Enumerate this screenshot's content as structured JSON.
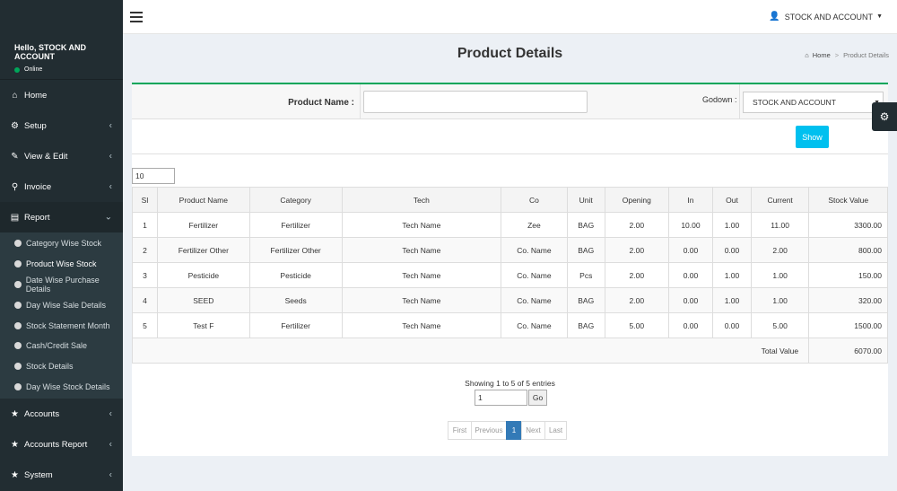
{
  "sidebar": {
    "greeting": "Hello, STOCK AND ACCOUNT",
    "status": "Online",
    "items": {
      "home": "Home",
      "setup": "Setup",
      "view_edit": "View & Edit",
      "invoice": "Invoice",
      "report": "Report",
      "accounts": "Accounts",
      "accounts_report": "Accounts Report",
      "system": "System"
    },
    "report_sub": [
      "Category Wise Stock",
      "Product Wise Stock",
      "Date Wise Purchase Details",
      "Day Wise Sale Details",
      "Stock Statement Month",
      "Cash/Credit Sale",
      "Stock Details",
      "Day Wise Stock Details"
    ]
  },
  "header": {
    "user": "STOCK AND ACCOUNT"
  },
  "page": {
    "title": "Product Details",
    "breadcrumb_home": "Home",
    "breadcrumb_current": "Product Details"
  },
  "filters": {
    "product_label": "Product Name :",
    "product_value": "",
    "godown_label": "Godown :",
    "godown_value": "STOCK AND ACCOUNT",
    "show_label": "Show"
  },
  "table": {
    "page_length": "10",
    "columns": [
      "Sl",
      "Product Name",
      "Category",
      "Tech",
      "Co",
      "Unit",
      "Opening",
      "In",
      "Out",
      "Current",
      "Stock Value"
    ],
    "rows": [
      [
        "1",
        "Fertilizer",
        "Fertilizer",
        "Tech Name",
        "Zee",
        "BAG",
        "2.00",
        "10.00",
        "1.00",
        "11.00",
        "3300.00"
      ],
      [
        "2",
        "Fertilizer Other",
        "Fertilizer Other",
        "Tech Name",
        "Co. Name",
        "BAG",
        "2.00",
        "0.00",
        "0.00",
        "2.00",
        "800.00"
      ],
      [
        "3",
        "Pesticide",
        "Pesticide",
        "Tech Name",
        "Co. Name",
        "Pcs",
        "2.00",
        "0.00",
        "1.00",
        "1.00",
        "150.00"
      ],
      [
        "4",
        "SEED",
        "Seeds",
        "Tech Name",
        "Co. Name",
        "BAG",
        "2.00",
        "0.00",
        "1.00",
        "1.00",
        "320.00"
      ],
      [
        "5",
        "Test F",
        "Fertilizer",
        "Tech Name",
        "Co. Name",
        "BAG",
        "5.00",
        "0.00",
        "0.00",
        "5.00",
        "1500.00"
      ]
    ],
    "total_label": "Total Value",
    "total_value": "6070.00"
  },
  "footer": {
    "info": "Showing 1 to 5 of 5 entries",
    "goto_value": "1",
    "go_label": "Go",
    "pager": {
      "first": "First",
      "previous": "Previous",
      "current": "1",
      "next": "Next",
      "last": "Last"
    }
  },
  "colors": {
    "sidebar": "#222d32",
    "accent": "#00a65a",
    "show_button": "#00c0ef",
    "pager_active": "#337ab7"
  }
}
